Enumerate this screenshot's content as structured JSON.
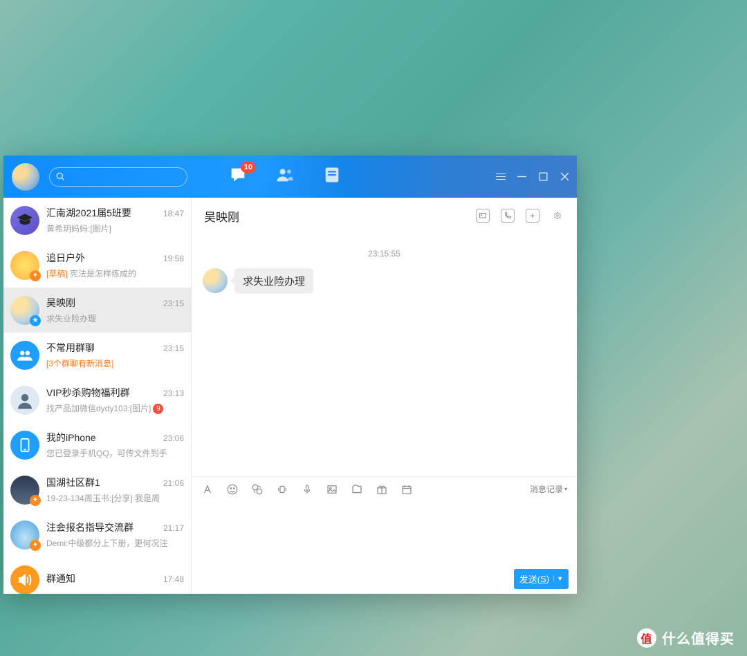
{
  "header": {
    "message_badge": "10",
    "search_placeholder": ""
  },
  "sidebar": [
    {
      "name": "汇南湖2021届5班要",
      "time": "18:47",
      "snippet": "黄希玥妈妈:[图片]",
      "avatar": "grad-cap"
    },
    {
      "name": "追日户外",
      "time": "19:58",
      "snippet_prefix": "[草稿] ",
      "snippet": "宪法是怎样练成的",
      "avatar": "sun"
    },
    {
      "name": "吴映刚",
      "time": "23:15",
      "snippet": "求失业险办理",
      "avatar": "person",
      "selected": true
    },
    {
      "name": "不常用群聊",
      "time": "23:15",
      "snippet_orange": "[3个群聊有新消息]",
      "avatar": "group-blue"
    },
    {
      "name": "VIP秒杀购物福利群",
      "time": "23:13",
      "snippet": "找产品加微信dydy103:[图片]",
      "avatar": "girl",
      "count": "9"
    },
    {
      "name": "我的iPhone",
      "time": "23:06",
      "snippet": "您已登录手机QQ，可传文件到手",
      "avatar": "phone"
    },
    {
      "name": "国湖社区群1",
      "time": "21:06",
      "snippet": "19-23-134周玉书:[分享] 我是周",
      "avatar": "photo"
    },
    {
      "name": "注会报名指导交流群",
      "time": "21:17",
      "snippet": "Demi:中级都分上下册，更何况注",
      "avatar": "mountain"
    },
    {
      "name": "群通知",
      "time": "17:48",
      "snippet": "",
      "avatar": "notice"
    }
  ],
  "chat": {
    "title": "吴映刚",
    "timestamp": "23:15:55",
    "message": "求失业险办理",
    "history_label": "消息记录",
    "send_label_prefix": "发送(",
    "send_key": "S",
    "send_label_suffix": ")"
  },
  "watermark": {
    "badge": "值",
    "text": "什么值得买"
  }
}
